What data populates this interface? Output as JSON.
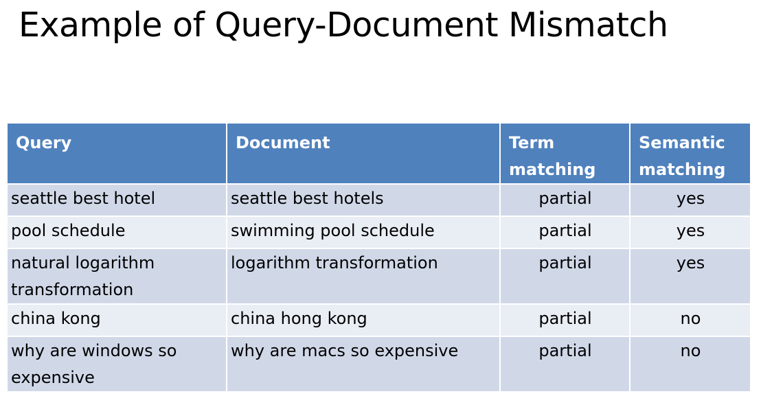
{
  "slide": {
    "title": "Example of Query-Document Mismatch"
  },
  "table": {
    "headers": {
      "query": "Query",
      "document": "Document",
      "term_matching": "Term matching",
      "semantic_matching": "Semantic matching"
    },
    "rows": [
      {
        "query": "seattle best hotel",
        "document": "seattle best hotels",
        "term_matching": "partial",
        "semantic_matching": "yes"
      },
      {
        "query": "pool schedule",
        "document": "swimming pool schedule",
        "term_matching": "partial",
        "semantic_matching": "yes"
      },
      {
        "query": "natural logarithm transformation",
        "document": "logarithm transformation",
        "term_matching": "partial",
        "semantic_matching": "yes"
      },
      {
        "query": "china kong",
        "document": "china hong kong",
        "term_matching": "partial",
        "semantic_matching": "no"
      },
      {
        "query": "why are windows so expensive",
        "document": "why are macs so expensive",
        "term_matching": "partial",
        "semantic_matching": "no"
      }
    ]
  },
  "colors": {
    "header_bg": "#4f81bd",
    "row_odd_bg": "#d0d8e8",
    "row_even_bg": "#e9edf4"
  }
}
